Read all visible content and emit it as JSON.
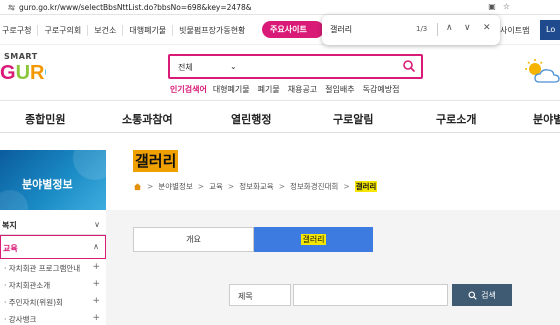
{
  "browser": {
    "url": "guro.go.kr/www/selectBbsNttList.do?bbsNo=698&key=2478&",
    "tools": [
      "star-icon",
      "extensions-icon"
    ]
  },
  "find": {
    "query": "갤러리",
    "count": "1/3"
  },
  "util": {
    "links": [
      "구로구청",
      "구로구의회",
      "보건소",
      "대행폐기물",
      "빗물펌프장가동현황"
    ],
    "major_label": "주요사이트",
    "sitemap": "사이트맵",
    "login": "Lo"
  },
  "logo": {
    "smart": "SMART",
    "guro": "GURO"
  },
  "search": {
    "scope": "전체",
    "placeholder": ""
  },
  "popular": {
    "label": "인기검색어",
    "keywords": [
      "대형폐기물",
      "폐기물",
      "채용공고",
      "절임배추",
      "독감예방접"
    ]
  },
  "gnb": [
    "종합민원",
    "소통과참여",
    "열린행정",
    "구로알림",
    "구로소개",
    "분야별"
  ],
  "sidebar": {
    "hero_title": "분야별정보",
    "items": [
      {
        "label": "복지",
        "arrow": "∨",
        "active": false
      },
      {
        "label": "교육",
        "arrow": "∧",
        "active": true
      }
    ],
    "subs": [
      "자치회관 프로그램안내",
      "자치회관소개",
      "주민자치(위원)회",
      "강사뱅크"
    ]
  },
  "content": {
    "title": "갤러리",
    "breadcrumb": [
      "분야별정보",
      "교육",
      "정보화교육",
      "정보화경진대회",
      "갤러리"
    ],
    "tabs": [
      "개요",
      "갤러리"
    ],
    "search_field": "제목",
    "search_button": "검색"
  },
  "colors": {
    "accent": "#d91b77",
    "tab_active": "#3d7be0",
    "highlight": "#f5e600",
    "title_bg": "#f0a000"
  }
}
